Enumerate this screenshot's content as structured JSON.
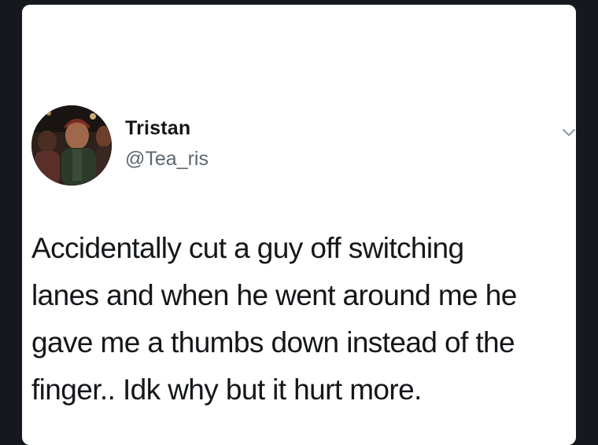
{
  "tweet": {
    "author": {
      "display_name": "Tristan",
      "handle": "@Tea_ris"
    },
    "text_lines": [
      "Accidentally cut a guy off switching",
      "lanes and when he went around me he",
      "gave me a thumbs down instead of the",
      "finger.. Idk why but it hurt more."
    ],
    "menu_icon": "chevron-down-icon",
    "colors": {
      "page_background": "#15181c",
      "card_background": "#ffffff",
      "text": "#14171a",
      "handle": "#5b6670"
    }
  }
}
